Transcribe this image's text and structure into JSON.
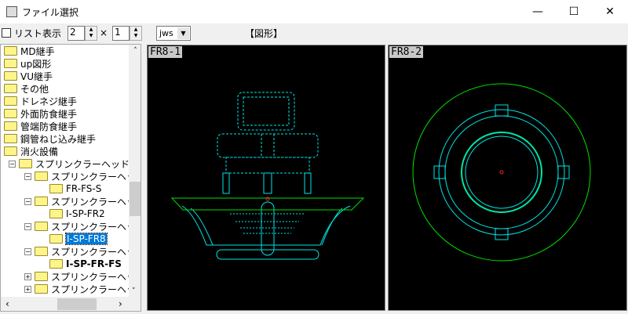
{
  "window": {
    "title": "ファイル選択",
    "minimize": "—",
    "maximize": "☐",
    "close": "✕"
  },
  "toolbar": {
    "list_view_label": "リスト表示",
    "cols": "2",
    "times": "×",
    "rows": "1",
    "ext": "jws",
    "heading": "【図形】"
  },
  "tree": {
    "items": [
      {
        "label": "MD継手"
      },
      {
        "label": "up図形"
      },
      {
        "label": "VU継手"
      },
      {
        "label": "その他"
      },
      {
        "label": "ドレネジ継手"
      },
      {
        "label": "外面防食継手"
      },
      {
        "label": "管端防食継手"
      },
      {
        "label": "鋼管ねじ込み継手"
      },
      {
        "label": "消火設備"
      },
      {
        "label": "スプリンクラーヘッド"
      },
      {
        "label": "スプリンクラーヘッド"
      },
      {
        "label": "FR-FS-S"
      },
      {
        "label": "スプリンクラーヘッド"
      },
      {
        "label": "I-SP-FR2"
      },
      {
        "label": "スプリンクラーヘッド"
      },
      {
        "label": "I-SP-FR8"
      },
      {
        "label": "スプリンクラーヘッド"
      },
      {
        "label": "I-SP-FR-FS"
      },
      {
        "label": "スプリンクラーヘッド"
      },
      {
        "label": "スプリンクラーヘッド"
      }
    ]
  },
  "previews": [
    {
      "label": "FR8-1"
    },
    {
      "label": "FR8-2"
    }
  ],
  "colors": {
    "cyan": "#00e5e5",
    "green": "#00e000",
    "red": "#ff2020",
    "selection": "#0078d7"
  }
}
